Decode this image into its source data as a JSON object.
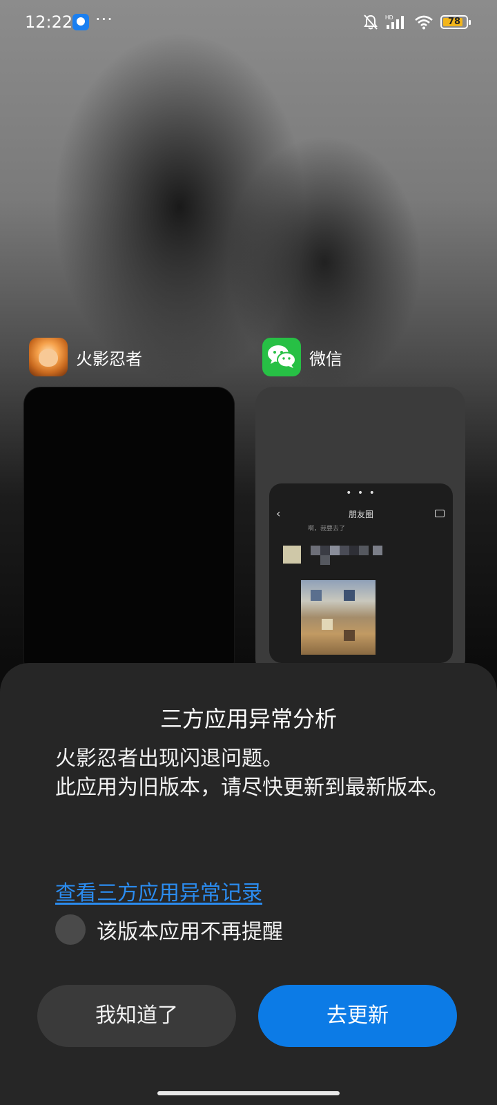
{
  "status_bar": {
    "time": "12:22",
    "more": "···",
    "battery": "78",
    "signal_label": "HD",
    "icons": [
      "notification-app-icon",
      "mute-bell-icon",
      "signal-icon",
      "wifi-icon",
      "battery-icon"
    ]
  },
  "recents": {
    "apps": [
      {
        "name": "火影忍者",
        "icon": "naruto-app-icon"
      },
      {
        "name": "微信",
        "icon": "wechat-app-icon"
      }
    ],
    "wechat_preview": {
      "dots": "• • •",
      "back": "‹",
      "title": "朋友圈",
      "subtext": "啊，我要去了"
    }
  },
  "dialog": {
    "title": "三方应用异常分析",
    "message_line1": "火影忍者出现闪退问题。",
    "message_line2": "此应用为旧版本，请尽快更新到最新版本。",
    "link": "查看三方应用异常记录",
    "checkbox_label": "该版本应用不再提醒",
    "checkbox_checked": false,
    "dismiss_button": "我知道了",
    "update_button": "去更新"
  },
  "colors": {
    "accent": "#0c7be6",
    "link": "#2b8cf0",
    "dialog_bg": "#262626",
    "battery": "#f2b51b"
  }
}
